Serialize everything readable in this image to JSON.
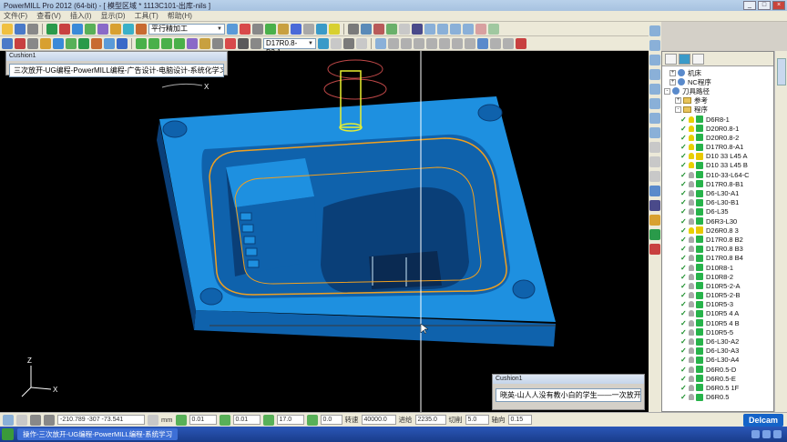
{
  "window": {
    "title": "PowerMILL Pro 2012 (64-bit) - [ 模型区域 * 1113C101-出库-nils ]",
    "min": "_",
    "max": "□",
    "close": "×"
  },
  "menu": [
    "文件(F)",
    "查看(V)",
    "插入(I)",
    "显示(D)",
    "工具(T)",
    "帮助(H)"
  ],
  "toolbar1": {
    "strategy_combo": "平行精加工"
  },
  "toolbar2": {
    "tool_combo": "D17R0.8-B2.1"
  },
  "viewport": {
    "floating_title_1": "Cushion1",
    "floating_text_1": "三次放开-UG编程-PowerMILL编程-广告设计-电脑设计-系统化学习",
    "floating_title_2": "Cushion1",
    "floating_text_2": "晓英-山人人没有教小白的学生——一次放开",
    "workplane_axis": "X",
    "triad_z": "Z",
    "triad_x": "X"
  },
  "explorer": {
    "tree": [
      {
        "label": "机床",
        "icon": "machine-icon",
        "indent": 1,
        "expander": "+"
      },
      {
        "label": "NC程序",
        "icon": "nc-program-icon",
        "indent": 1,
        "expander": "+"
      },
      {
        "label": "刀具路径",
        "icon": "toolpath-folder-icon",
        "indent": 0,
        "expander": "-"
      },
      {
        "label": "参考",
        "icon": "folder-icon",
        "indent": 2,
        "expander": "+"
      },
      {
        "label": "程序",
        "icon": "folder-icon",
        "indent": 2,
        "expander": "-"
      },
      {
        "label": "D6R8-1",
        "indent": 3,
        "checked": true,
        "light": true,
        "status": "ok"
      },
      {
        "label": "D20R0.8-1",
        "indent": 3,
        "checked": true,
        "light": true,
        "status": "ok"
      },
      {
        "label": "D20R0.8-2",
        "indent": 3,
        "checked": true,
        "light": true,
        "status": "ok"
      },
      {
        "label": "D17R0.8-A1",
        "indent": 3,
        "checked": true,
        "light": true,
        "status": "ok"
      },
      {
        "label": "D10 33 L45 A",
        "indent": 3,
        "checked": true,
        "light": true,
        "status": "warn"
      },
      {
        "label": "D10 33 L45 B",
        "indent": 3,
        "checked": true,
        "light": true,
        "status": "ok"
      },
      {
        "label": "D10-33-L64-C",
        "indent": 3,
        "checked": true,
        "light": false,
        "status": "ok"
      },
      {
        "label": "D17R0.8-B1",
        "indent": 3,
        "checked": true,
        "light": false,
        "status": "ok"
      },
      {
        "label": "D6-L30-A1",
        "indent": 3,
        "checked": true,
        "light": false,
        "status": "ok"
      },
      {
        "label": "D6-L30-B1",
        "indent": 3,
        "checked": true,
        "light": false,
        "status": "ok"
      },
      {
        "label": "D6-L35",
        "indent": 3,
        "checked": true,
        "light": false,
        "status": "ok"
      },
      {
        "label": "D6R3-L30",
        "indent": 3,
        "checked": true,
        "light": false,
        "status": "ok"
      },
      {
        "label": "D26R0.8 3",
        "indent": 3,
        "checked": true,
        "light": true,
        "status": "warn"
      },
      {
        "label": "D17R0.8 B2",
        "indent": 3,
        "checked": true,
        "light": false,
        "status": "ok"
      },
      {
        "label": "D17R0.8 B3",
        "indent": 3,
        "checked": true,
        "light": false,
        "status": "ok"
      },
      {
        "label": "D17R0.8 B4",
        "indent": 3,
        "checked": true,
        "light": false,
        "status": "ok"
      },
      {
        "label": "D10R8-1",
        "indent": 3,
        "checked": true,
        "light": false,
        "status": "ok"
      },
      {
        "label": "D10R8-2",
        "indent": 3,
        "checked": true,
        "light": false,
        "status": "ok"
      },
      {
        "label": "D10R5-2-A",
        "indent": 3,
        "checked": true,
        "light": false,
        "status": "ok"
      },
      {
        "label": "D10R5-2-B",
        "indent": 3,
        "checked": true,
        "light": false,
        "status": "ok"
      },
      {
        "label": "D10R5-3",
        "indent": 3,
        "checked": true,
        "light": false,
        "status": "ok"
      },
      {
        "label": "D10R5 4 A",
        "indent": 3,
        "checked": true,
        "light": false,
        "status": "ok"
      },
      {
        "label": "D10R5 4 B",
        "indent": 3,
        "checked": true,
        "light": false,
        "status": "ok"
      },
      {
        "label": "D10R5-5",
        "indent": 3,
        "checked": true,
        "light": false,
        "status": "ok"
      },
      {
        "label": "D6-L30-A2",
        "indent": 3,
        "checked": true,
        "light": false,
        "status": "ok"
      },
      {
        "label": "D6-L30-A3",
        "indent": 3,
        "checked": true,
        "light": false,
        "status": "ok"
      },
      {
        "label": "D6-L30-A4",
        "indent": 3,
        "checked": true,
        "light": false,
        "status": "ok"
      },
      {
        "label": "D6R0.5-D",
        "indent": 3,
        "checked": true,
        "light": false,
        "status": "ok"
      },
      {
        "label": "D6R0.5-E",
        "indent": 3,
        "checked": true,
        "light": false,
        "status": "ok"
      },
      {
        "label": "D6R0.5 1F",
        "indent": 3,
        "checked": true,
        "light": false,
        "status": "ok"
      },
      {
        "label": "D6R0.5",
        "indent": 3,
        "checked": true,
        "light": false,
        "status": "ok"
      }
    ]
  },
  "status": {
    "coords": "-210.789 -307 -73.541",
    "unit": "mm",
    "tol1": "0.01",
    "tol2": "0.01",
    "stepover": "17.0",
    "thickness": "0.0",
    "speed_label": "转速",
    "speed_val": "40000.0",
    "feed_label": "进给",
    "feed_val": "2235.0",
    "cut_label": "切削",
    "cut_val": "5.0",
    "axis_label": "轴向",
    "axis_val": "0.15",
    "logo": "Delcam"
  },
  "taskbar": {
    "task1": "操作-三次放开-UG编程-PowerMILL编程-系统学习"
  },
  "colors": {
    "mold": "#1e90e0",
    "mold_dark": "#0f62ac",
    "mold_shadow": "#0a3f78",
    "toolpath": "#f0a020",
    "tool": "#e8ef30",
    "viewport_bg": "#000000"
  }
}
